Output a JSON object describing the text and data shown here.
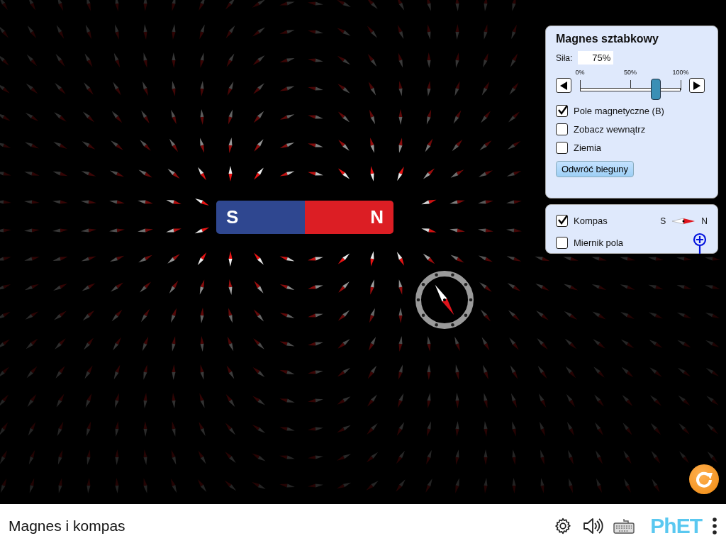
{
  "magnet_panel": {
    "title": "Magnes sztabkowy",
    "strength_label": "Siła:",
    "strength_value": "75%",
    "slider": {
      "level": 0.75,
      "ticks": [
        "0%",
        "50%",
        "100%"
      ]
    },
    "options": [
      {
        "label": "Pole magnetyczne (B)",
        "checked": true
      },
      {
        "label": "Zobacz wewnątrz",
        "checked": false
      },
      {
        "label": "Ziemia",
        "checked": false
      }
    ],
    "flip_button": "Odwróć bieguny"
  },
  "tools_panel": {
    "items": [
      {
        "kind": "compass",
        "label": "Kompas",
        "checked": true,
        "legend_s": "S",
        "legend_n": "N"
      },
      {
        "kind": "field_meter",
        "label": "Miernik pola",
        "checked": false
      }
    ]
  },
  "magnet": {
    "south_label": "S",
    "north_label": "N"
  },
  "nav_bar": {
    "title": "Magnes i kompas",
    "logo": "PhET"
  }
}
